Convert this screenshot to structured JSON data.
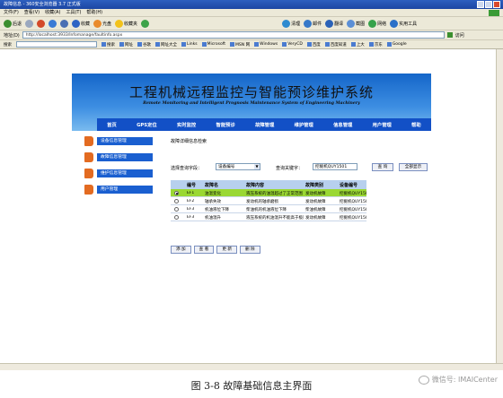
{
  "window": {
    "title": "故障信息 - 360安全浏览器 3.7 正式版"
  },
  "menu": [
    "文件(F)",
    "查看(V)",
    "收藏(A)",
    "工具(T)",
    "帮助(H)"
  ],
  "toolbar": {
    "back": "后退",
    "collect": "收藏",
    "open": "光盘",
    "favorites": "收藏夹",
    "clean": "清理",
    "mail": "邮件",
    "translate": "翻译",
    "screenshot": "截图",
    "network": "网络",
    "tools": "实用工具"
  },
  "address": {
    "label": "地址(D)",
    "url": "http://localhost:3933/Infomanage/faultinfo.aspx",
    "go": "访问"
  },
  "links": {
    "label": "搜索",
    "search": "搜索",
    "items": [
      "网址",
      "谷歌",
      "网址大全",
      "Links",
      "Microsoft",
      "MSN 网",
      "Windows",
      "VeryCD",
      "百度",
      "百度知道",
      "上大",
      "京东",
      "Google"
    ]
  },
  "banner": {
    "title": "工程机械远程监控与智能预诊维护系统",
    "subtitle": "Remote Monitoring and Intelligent Prognosis Maintenance System of Engineering Machinery"
  },
  "nav": [
    "首页",
    "GPS定位",
    "实时监控",
    "智能预诊",
    "故障管理",
    "维护管理",
    "信息管理",
    "用户管理",
    "帮助"
  ],
  "sidebar": [
    "设备信息管理",
    "故障信息管理",
    "维护信息管理",
    "用户管理"
  ],
  "content": {
    "title": "故障详细信息检索",
    "filter": {
      "field_label": "选择查询字段：",
      "field_value": "设备编号",
      "keyword_label": "查询关键字：",
      "keyword_value": "挖掘机QUY1501",
      "query_button": "查 询",
      "show_all_button": "全部显示"
    },
    "grid": {
      "headers": [
        "编号",
        "故障名",
        "故障内容",
        "故障类别",
        "设备编号"
      ],
      "rows": [
        {
          "id": "EF1",
          "name": "油温变化",
          "content": "液压系统的油温超过了正常范围",
          "category": "发动机故障",
          "device": "挖掘机QUY1501",
          "selected": true
        },
        {
          "id": "EF2",
          "name": "轴承失效",
          "content": "发动机的轴承磨损",
          "category": "发动机故障",
          "device": "挖掘机QUY1501",
          "selected": false
        },
        {
          "id": "EF3",
          "name": "机油液位下降",
          "content": "柴油机的机油液位下降",
          "category": "柴油机故障",
          "device": "挖掘机QUY1501",
          "selected": false
        },
        {
          "id": "EF3",
          "name": "机油温升",
          "content": "液压系统的机油温升不能高于极限值",
          "category": "发动机故障",
          "device": "挖掘机QUY1501",
          "selected": false
        }
      ]
    },
    "actions": [
      "添 加",
      "查 看",
      "更 新",
      "删 除"
    ]
  },
  "caption": "图 3-8  故障基础信息主界面",
  "watermark": "微信号: IMAICenter",
  "colors": {
    "nav_bg": "#1250c6",
    "sidebar_bg": "#1a5fd0",
    "bullet": "#e36b21",
    "selected_row": "#9ad833",
    "grid_header": "#b7d0ee"
  }
}
